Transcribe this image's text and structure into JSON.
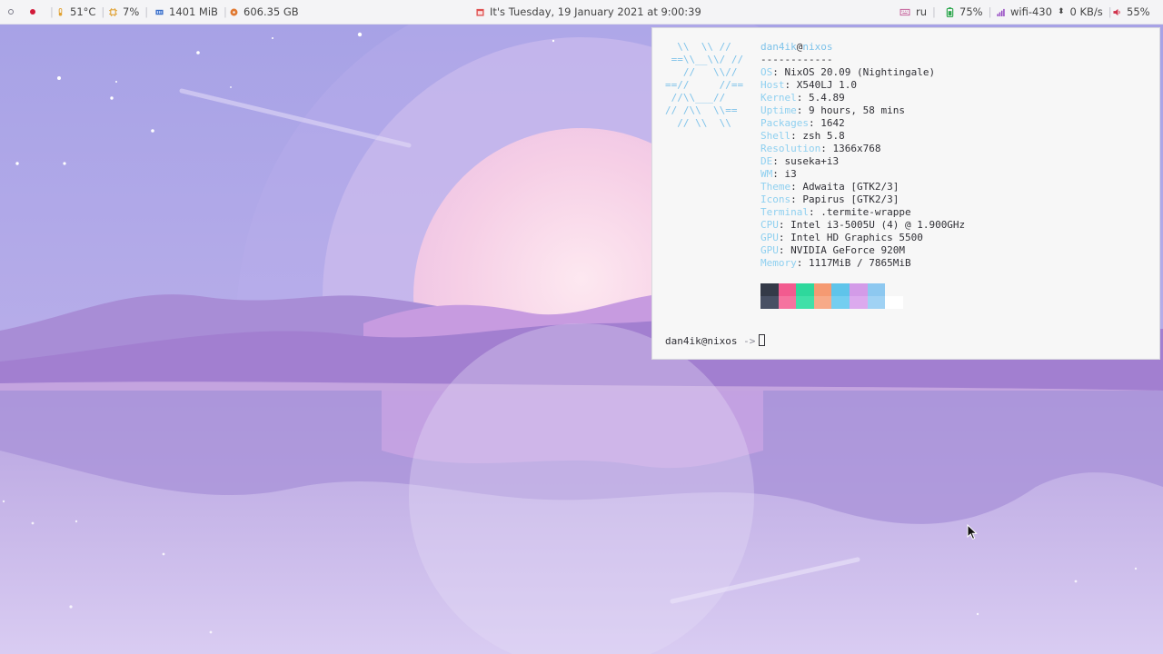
{
  "topbar": {
    "temperature": "51°C",
    "cpu": "7%",
    "memory": "1401 MiB",
    "disk": "606.35 GB",
    "datetime": "It's Tuesday, 19 January 2021 at  9:00:39",
    "keyboard_layout": "ru",
    "battery": "75%",
    "wifi": "wifi-430",
    "net_speed": "0 KB/s",
    "volume": "55%"
  },
  "terminal": {
    "logo": "  \\\\  \\\\ //\n ==\\\\__\\\\/ //\n   //   \\\\//\n==//     //==\n //\\\\___//\n// /\\\\  \\\\==\n  // \\\\  \\\\",
    "user": "dan4ik",
    "at": "@",
    "host": "nixos",
    "separator": "------------",
    "info": [
      {
        "key": "OS",
        "value": "NixOS 20.09 (Nightingale)"
      },
      {
        "key": "Host",
        "value": "X540LJ 1.0"
      },
      {
        "key": "Kernel",
        "value": "5.4.89"
      },
      {
        "key": "Uptime",
        "value": "9 hours, 58 mins"
      },
      {
        "key": "Packages",
        "value": "1642"
      },
      {
        "key": "Shell",
        "value": "zsh 5.8"
      },
      {
        "key": "Resolution",
        "value": "1366x768"
      },
      {
        "key": "DE",
        "value": "suseka+i3"
      },
      {
        "key": "WM",
        "value": "i3"
      },
      {
        "key": "Theme",
        "value": "Adwaita [GTK2/3]"
      },
      {
        "key": "Icons",
        "value": "Papirus [GTK2/3]"
      },
      {
        "key": "Terminal",
        "value": ".termite-wrappe"
      },
      {
        "key": "CPU",
        "value": "Intel i3-5005U (4) @ 1.900GHz"
      },
      {
        "key": "GPU",
        "value": "Intel HD Graphics 5500"
      },
      {
        "key": "GPU",
        "value": "NVIDIA GeForce 920M"
      },
      {
        "key": "Memory",
        "value": "1117MiB / 7865MiB"
      }
    ],
    "colors_top": [
      "#343a48",
      "#f25b8f",
      "#2ed89c",
      "#f59a72",
      "#5fc4ea",
      "#d39be8",
      "#8dc8f0",
      "#f7f7f7"
    ],
    "colors_bottom": [
      "#485064",
      "#f5739f",
      "#40e0a8",
      "#f7aa88",
      "#74cef0",
      "#dcaaee",
      "#a0d2f4",
      "#ffffff"
    ],
    "prompt_user": "dan4ik@nixos",
    "prompt_arrow": "->"
  },
  "colors": {
    "workspace_active": "#d21a3a",
    "key_color": "#8fd0f0"
  }
}
